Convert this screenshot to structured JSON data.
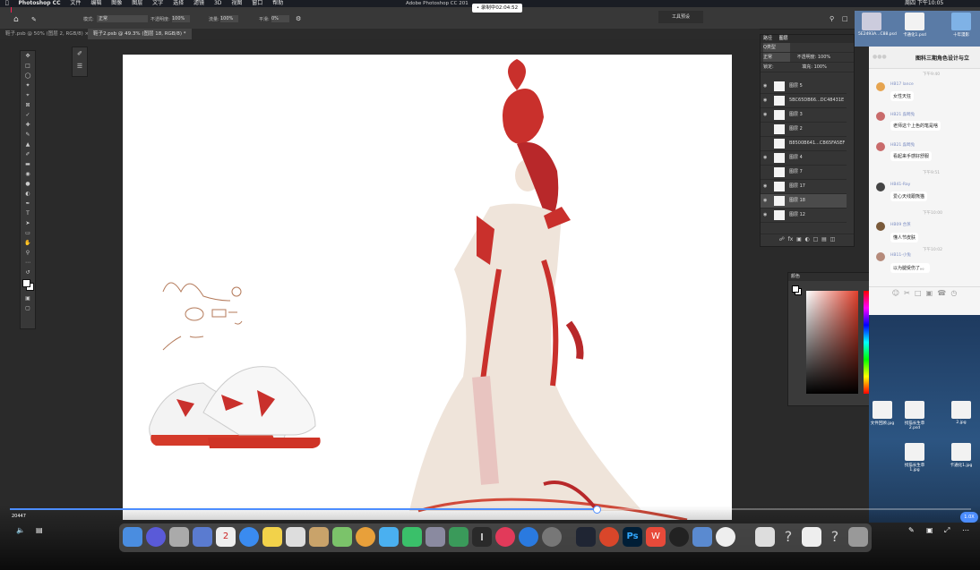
{
  "menubar": {
    "app_name": "Photoshop CC",
    "items": [
      "文件",
      "编辑",
      "图像",
      "图层",
      "文字",
      "选择",
      "滤镜",
      "3D",
      "视图",
      "窗口",
      "帮助"
    ],
    "window_title": "Adobe Photoshop CC 201",
    "record_badge": "• 录制中02:04:52",
    "clock": "周四 下午10:05"
  },
  "options": {
    "mode_label": "模式:",
    "mode_value": "正常",
    "opacity_label": "不透明度:",
    "opacity_value": "100%",
    "flow_label": "流量:",
    "flow_value": "100%",
    "smooth_label": "平滑:",
    "smooth_value": "0%",
    "workspace_label": "工具预设"
  },
  "tabs": [
    {
      "label": "鞋子.psb @ 50% (图层 2, RGB/8) ×"
    },
    {
      "label": "鞋子2.psb @ 49.3% (图层 18, RGB/8) *"
    }
  ],
  "layers_panel": {
    "tab1": "路径",
    "tab2": "图层",
    "filter": "Q类型",
    "blend": "正常",
    "opacity_label": "不透明度:",
    "opacity_value": "100%",
    "lock_label": "锁定:",
    "fill_label": "填充:",
    "fill_value": "100%",
    "layers": [
      {
        "name": "图层 5",
        "visible": true
      },
      {
        "name": "5BC65DB66...DC48431E",
        "visible": true
      },
      {
        "name": "图层 3",
        "visible": true
      },
      {
        "name": "图层 2",
        "visible": false
      },
      {
        "name": "B8500B641...CB65FA5EF",
        "visible": false
      },
      {
        "name": "图层 4",
        "visible": true
      },
      {
        "name": "图层 7",
        "visible": false
      },
      {
        "name": "图层 17",
        "visible": true
      },
      {
        "name": "图层 18",
        "visible": true,
        "selected": true
      },
      {
        "name": "图层 12",
        "visible": true
      }
    ]
  },
  "color_panel": {
    "title": "颜色"
  },
  "chat": {
    "title": "图科三期角色设计与立",
    "time1": "下午9:40",
    "messages": [
      {
        "sender": "HB17 lance",
        "text": "女性天狂",
        "color": "#e6a44f"
      },
      {
        "sender": "HB21 淼畸兔",
        "text": "老师这个上色的笔是啥",
        "color": "#c96b6b"
      },
      {
        "sender": "HB21 淼畸兔",
        "text": "看起来手感好舒服",
        "color": "#c96b6b"
      },
      {
        "sender": "HB41-Ray",
        "text": "爱心天线跟熊猫",
        "color": "#444444"
      },
      {
        "sender": "HB09 合蒸",
        "text": "懂人节皮肤",
        "color": "#7a5a3a"
      },
      {
        "sender": "HB11-小兔",
        "text": "以为腿受伤了。。",
        "color": "#b58a7a"
      }
    ],
    "time2": "下午9:51",
    "time3": "下午10:00",
    "time4": "下午10:02"
  },
  "desktop_files": [
    {
      "label": "5E2493A...C88.psd"
    },
    {
      "label": "卡通化1.psd"
    },
    {
      "label": "十年漫影"
    },
    {
      "label": "文件回顾.jpg"
    },
    {
      "label": "找猫长生草2.psd"
    },
    {
      "label": "2.jpg"
    },
    {
      "label": "找猫长生草1.jpg"
    },
    {
      "label": "卡通化1.jpg"
    }
  ],
  "video": {
    "elapsed": "20447",
    "speed_label": "1.0X",
    "progress": 0.61
  },
  "colors": {
    "accent": "#4c8dff",
    "dress_red": "#c9302c"
  }
}
